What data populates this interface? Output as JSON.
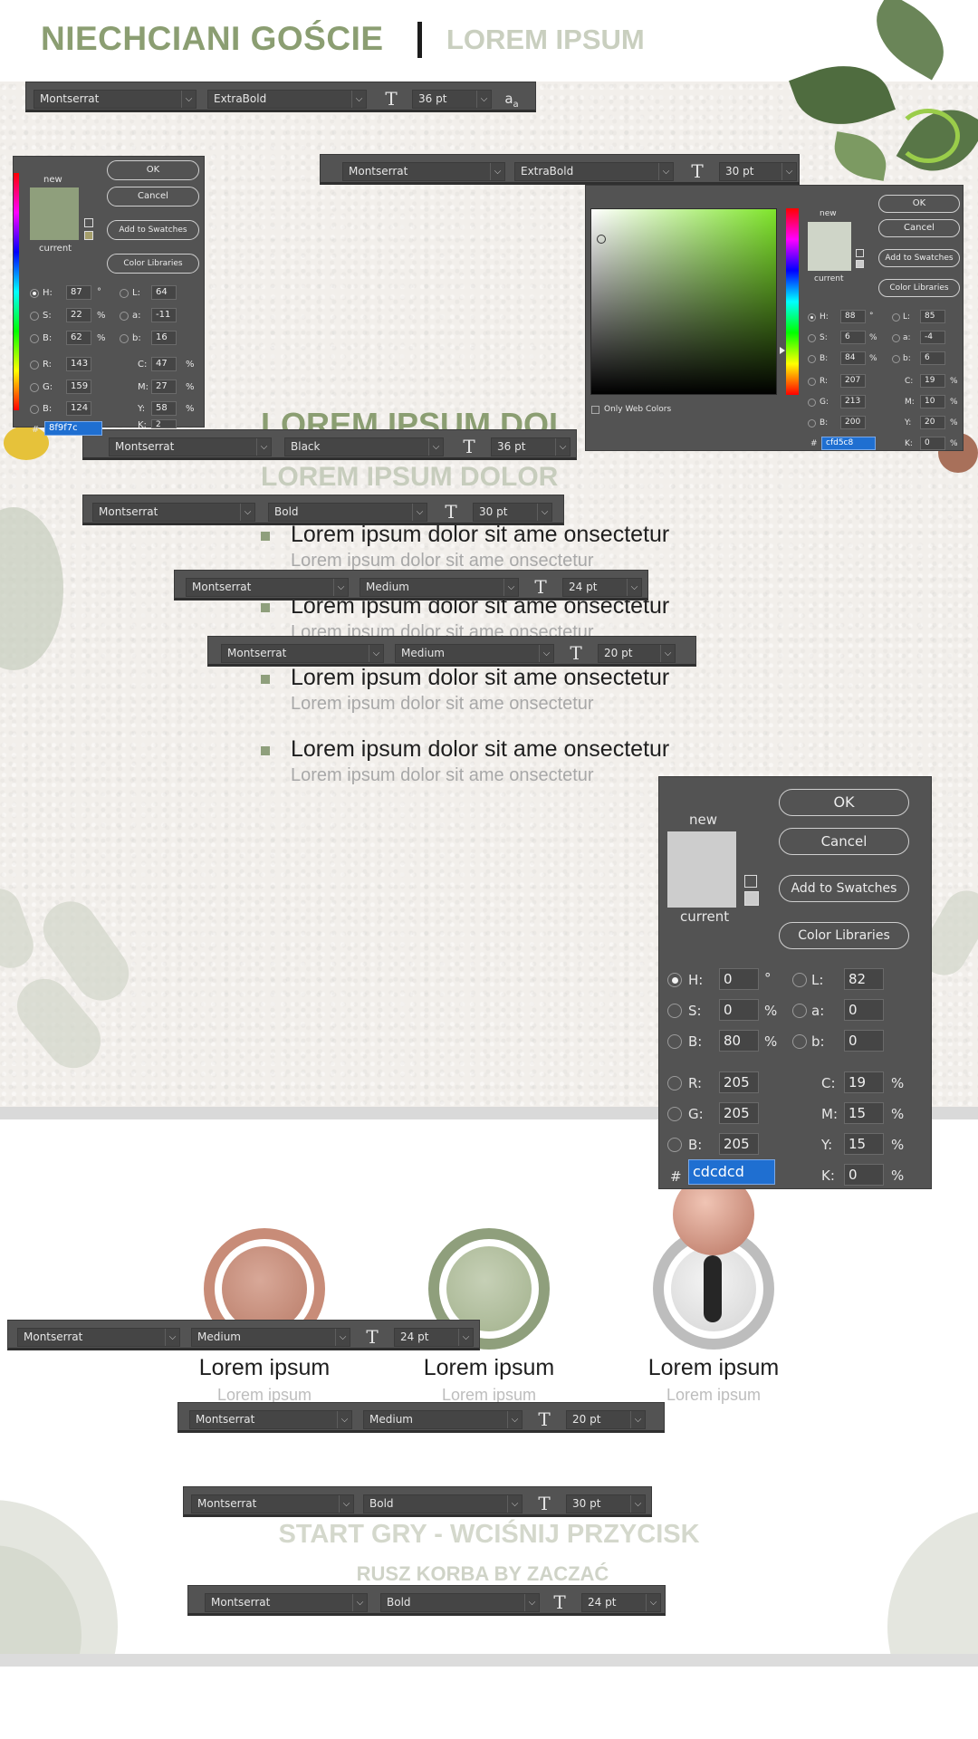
{
  "header": {
    "title": "NIECHCIANI GOŚCIE",
    "subtitle": "LOREM IPSUM"
  },
  "content": {
    "heading_black": "LOREM IPSUM DOL",
    "heading_bold": "LOREM IPSUM DOLOR",
    "list_items": [
      {
        "main": "Lorem ipsum dolor sit ame onsectetur",
        "sub": "Lorem ipsum dolor sit ame onsectetur"
      },
      {
        "main": "Lorem ipsum dolor sit ame onsectetur",
        "sub": "Lorem ipsum dolor sit ame onsectetur"
      },
      {
        "main": "Lorem ipsum dolor sit ame onsectetur",
        "sub": "Lorem ipsum dolor sit ame onsectetur"
      },
      {
        "main": "Lorem ipsum dolor sit ame onsectetur",
        "sub": "Lorem ipsum dolor sit ame onsectetur"
      }
    ]
  },
  "buttons": [
    {
      "label": "Lorem ipsum",
      "sub": "Lorem ipsum"
    },
    {
      "label": "Lorem ipsum",
      "sub": "Lorem ipsum"
    },
    {
      "label": "Lorem ipsum",
      "sub": "Lorem ipsum"
    }
  ],
  "start": {
    "title": "START GRY - WCIŚNIJ PRZYCISK",
    "subtitle": "RUSZ KORBA BY ZACZAĆ"
  },
  "toolbars": [
    {
      "font": "Montserrat",
      "weight": "ExtraBold",
      "size": "36 pt",
      "aa": "a"
    },
    {
      "font": "Montserrat",
      "weight": "ExtraBold",
      "size": "30 pt"
    },
    {
      "font": "Montserrat",
      "weight": "Black",
      "size": "36 pt"
    },
    {
      "font": "Montserrat",
      "weight": "Bold",
      "size": "30 pt"
    },
    {
      "font": "Montserrat",
      "weight": "Medium",
      "size": "24 pt"
    },
    {
      "font": "Montserrat",
      "weight": "Medium",
      "size": "20 pt"
    },
    {
      "font": "Montserrat",
      "weight": "Medium",
      "size": "24 pt"
    },
    {
      "font": "Montserrat",
      "weight": "Medium",
      "size": "20 pt"
    },
    {
      "font": "Montserrat",
      "weight": "Bold",
      "size": "30 pt"
    },
    {
      "font": "Montserrat",
      "weight": "Bold",
      "size": "24 pt"
    }
  ],
  "color_pickers": [
    {
      "ok": "OK",
      "cancel": "Cancel",
      "add_to_swatches": "Add to Swatches",
      "color_libraries": "Color Libraries",
      "new_label": "new",
      "current_label": "current",
      "new_color": "#8f9f7c",
      "current_color": "#8f9f7c",
      "H": "87",
      "S": "22",
      "B": "62",
      "R": "143",
      "G": "159",
      "Bv": "124",
      "L": "64",
      "a": "-11",
      "b": "16",
      "C": "47",
      "M": "27",
      "Y": "58",
      "K": "2",
      "hex": "8f9f7c",
      "h_label": "H:",
      "s_label": "S:",
      "b_label": "B:",
      "r_label": "R:",
      "g_label": "G:",
      "bl_label": "B:",
      "l_label": "L:",
      "a_label": "a:",
      "bb_label": "b:",
      "c_label": "C:",
      "m_label": "M:",
      "y_label": "Y:",
      "k_label": "K:",
      "deg": "°",
      "pct": "%",
      "hash": "#"
    },
    {
      "ok": "OK",
      "cancel": "Cancel",
      "add_to_swatches": "Add to Swatches",
      "color_libraries": "Color Libraries",
      "new_label": "new",
      "current_label": "current",
      "new_color": "#cfd5c8",
      "current_color": "#cfd5c8",
      "H": "88",
      "S": "6",
      "B": "84",
      "R": "207",
      "G": "213",
      "Bv": "200",
      "L": "85",
      "a": "-4",
      "b": "6",
      "C": "19",
      "M": "10",
      "Y": "20",
      "K": "0",
      "hex": "cfd5c8",
      "only_web_colors": "Only Web Colors",
      "field_hue_color": "#7fe52b",
      "h_label": "H:",
      "s_label": "S:",
      "b_label": "B:",
      "r_label": "R:",
      "g_label": "G:",
      "bl_label": "B:",
      "l_label": "L:",
      "a_label": "a:",
      "bb_label": "b:",
      "c_label": "C:",
      "m_label": "M:",
      "y_label": "Y:",
      "k_label": "K:",
      "deg": "°",
      "pct": "%",
      "hash": "#"
    },
    {
      "ok": "OK",
      "cancel": "Cancel",
      "add_to_swatches": "Add to Swatches",
      "color_libraries": "Color Libraries",
      "new_label": "new",
      "current_label": "current",
      "new_color": "#cdcdcd",
      "current_color": "#cdcdcd",
      "H": "0",
      "S": "0",
      "B": "80",
      "R": "205",
      "G": "205",
      "Bv": "205",
      "L": "82",
      "a": "0",
      "b": "0",
      "C": "19",
      "M": "15",
      "Y": "15",
      "K": "0",
      "hex": "cdcdcd",
      "h_label": "H:",
      "s_label": "S:",
      "b_label": "B:",
      "r_label": "R:",
      "g_label": "G:",
      "bl_label": "B:",
      "l_label": "L:",
      "a_label": "a:",
      "bb_label": "b:",
      "c_label": "C:",
      "m_label": "M:",
      "y_label": "Y:",
      "k_label": "K:",
      "deg": "°",
      "pct": "%",
      "hash": "#"
    }
  ],
  "colors": {
    "title_green": "#8b9e72",
    "pale_green": "#c9cfbf",
    "terracotta": "#c88c78",
    "sage": "#8f9f7c",
    "grey": "#bdbdbd",
    "photoshop_panel": "#535353"
  }
}
